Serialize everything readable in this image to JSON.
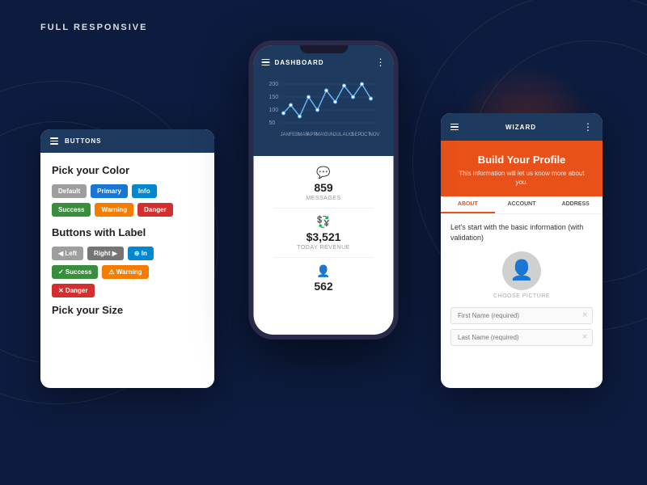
{
  "page": {
    "label": "FULL RESPONSIVE",
    "bg_color": "#0d1b3e"
  },
  "left_card": {
    "header_title": "BUTTONS",
    "section1_title": "Pick your Color",
    "btn_row1": [
      {
        "label": "Default",
        "class": "btn-default"
      },
      {
        "label": "Primary",
        "class": "btn-primary"
      },
      {
        "label": "Info",
        "class": "btn-info"
      }
    ],
    "btn_row2": [
      {
        "label": "Success",
        "class": "btn-success"
      },
      {
        "label": "Warning",
        "class": "btn-warning"
      },
      {
        "label": "Danger",
        "class": "btn-danger"
      }
    ],
    "section2_title": "Buttons with Label",
    "btn_label_row1": [
      {
        "label": "◀ Left",
        "class": "btn-left-gray"
      },
      {
        "label": "Right ▶",
        "class": "btn-right-gray"
      },
      {
        "label": "⊕ In",
        "class": "btn-info-sm"
      }
    ],
    "btn_label_row2": [
      {
        "label": "✓ Success",
        "class": "btn-success"
      },
      {
        "label": "⚠ Warning",
        "class": "btn-warning"
      }
    ],
    "btn_label_row3": [
      {
        "label": "✕ Danger",
        "class": "btn-danger"
      }
    ],
    "section3_title": "Pick your Size"
  },
  "center_phone": {
    "header_title": "DASHBOARD",
    "chart": {
      "y_labels": [
        "200",
        "150",
        "100",
        "50"
      ],
      "x_labels": [
        "JAN",
        "FEB",
        "MAR",
        "APR",
        "MAY",
        "JUN",
        "JUL",
        "AUG",
        "SEP",
        "OCT",
        "NOV"
      ],
      "points": [
        [
          5,
          50
        ],
        [
          17,
          38
        ],
        [
          29,
          52
        ],
        [
          41,
          28
        ],
        [
          53,
          44
        ],
        [
          65,
          20
        ],
        [
          77,
          35
        ],
        [
          89,
          15
        ],
        [
          101,
          28
        ],
        [
          113,
          12
        ],
        [
          125,
          30
        ]
      ]
    },
    "stats": [
      {
        "icon": "💬",
        "value": "859",
        "label": "MESSAGES"
      },
      {
        "icon": "💱",
        "value": "$3,521",
        "label": "TODAY REVENUE"
      },
      {
        "icon": "👤",
        "value": "562",
        "label": ""
      }
    ]
  },
  "right_card": {
    "header_title": "WIZARD",
    "hero_title": "Build Your Profile",
    "hero_subtitle": "This information will let us know more about you.",
    "tabs": [
      {
        "label": "ABOUT",
        "active": true
      },
      {
        "label": "ACCOUNT",
        "active": false
      },
      {
        "label": "ADDRESS",
        "active": false
      }
    ],
    "body_subtitle": "Let's start with the basic information (with validation)",
    "avatar_label": "CHOOSE PICTURE",
    "fields": [
      {
        "placeholder": "First Name (required)"
      },
      {
        "placeholder": "Last Name (required)"
      }
    ]
  }
}
